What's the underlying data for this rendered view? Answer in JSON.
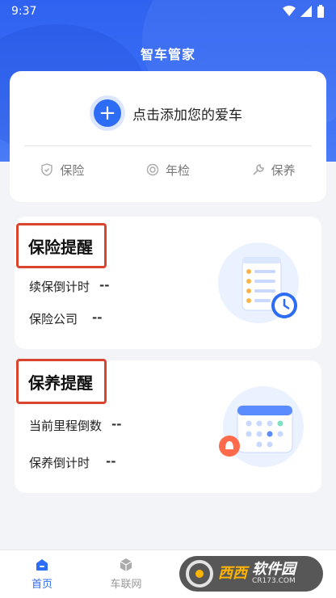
{
  "status_bar": {
    "time": "9:37"
  },
  "header": {
    "title": "智车管家"
  },
  "add_car": {
    "label": "点击添加您的爱车"
  },
  "quick_tabs": [
    {
      "label": "保险",
      "icon": "shield-icon"
    },
    {
      "label": "年检",
      "icon": "target-icon"
    },
    {
      "label": "保养",
      "icon": "wrench-icon"
    }
  ],
  "insurance_card": {
    "title": "保险提醒",
    "rows": [
      {
        "label": "续保倒计时",
        "value": "--"
      },
      {
        "label": "保险公司",
        "value": "--"
      }
    ]
  },
  "maintenance_card": {
    "title": "保养提醒",
    "rows": [
      {
        "label": "当前里程倒数",
        "value": "--"
      },
      {
        "label": "保养倒计时",
        "value": "--"
      }
    ]
  },
  "tabbar": {
    "items": [
      {
        "label": "首页",
        "icon": "home-icon",
        "active": true
      },
      {
        "label": "车联网",
        "icon": "cube-icon",
        "active": false
      }
    ]
  },
  "watermark": {
    "brand": "西西",
    "soft": "软件园",
    "domain": "CR173.COM"
  },
  "colors": {
    "accent": "#2d6cf5",
    "highlight_border": "#d9452f"
  }
}
